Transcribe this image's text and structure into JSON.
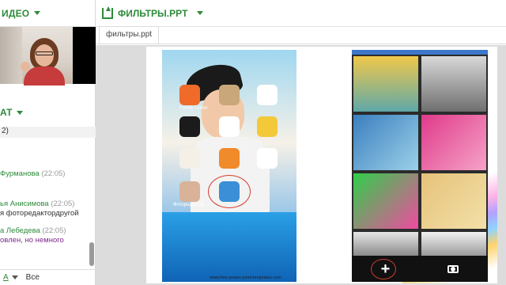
{
  "left_panel": {
    "video_title": "ИДЕО",
    "chat_title": "АТ",
    "chat_subtitle": "2)",
    "messages": [
      {
        "name": "Фурманова",
        "time": "(22:05)",
        "text": ""
      },
      {
        "name": "ья Анисимова",
        "time": "(22:05)",
        "text": "я  фоторедактордругой"
      },
      {
        "name": "а Лебедева",
        "time": "(22:05)",
        "text": "овлен, но немного"
      }
    ],
    "bottom_bar": {
      "text_tool": "A",
      "dropdown": "Все"
    }
  },
  "right_panel": {
    "title": "ФИЛЬТРЫ.PPT",
    "tab": "фильтры.ppt",
    "slide": {
      "url": "www.free-power-point-templates.com",
      "apps": [
        {
          "label": "Family Cutter",
          "color": "#f06a2a"
        },
        {
          "label": "",
          "color": "#c9a77b"
        },
        {
          "label": "",
          "color": "#ffffff"
        },
        {
          "label": "",
          "color": "#1b1b1b"
        },
        {
          "label": "",
          "color": "#ffffff"
        },
        {
          "label": "",
          "color": "#f3c93a"
        },
        {
          "label": "",
          "color": "#f4f0e8"
        },
        {
          "label": "",
          "color": "#f08a2a"
        },
        {
          "label": "",
          "color": "#ffffff"
        },
        {
          "label": "Фоторедактор",
          "color": "#d8b39a"
        },
        {
          "label": "",
          "color": "#3a8fd6"
        }
      ]
    }
  }
}
